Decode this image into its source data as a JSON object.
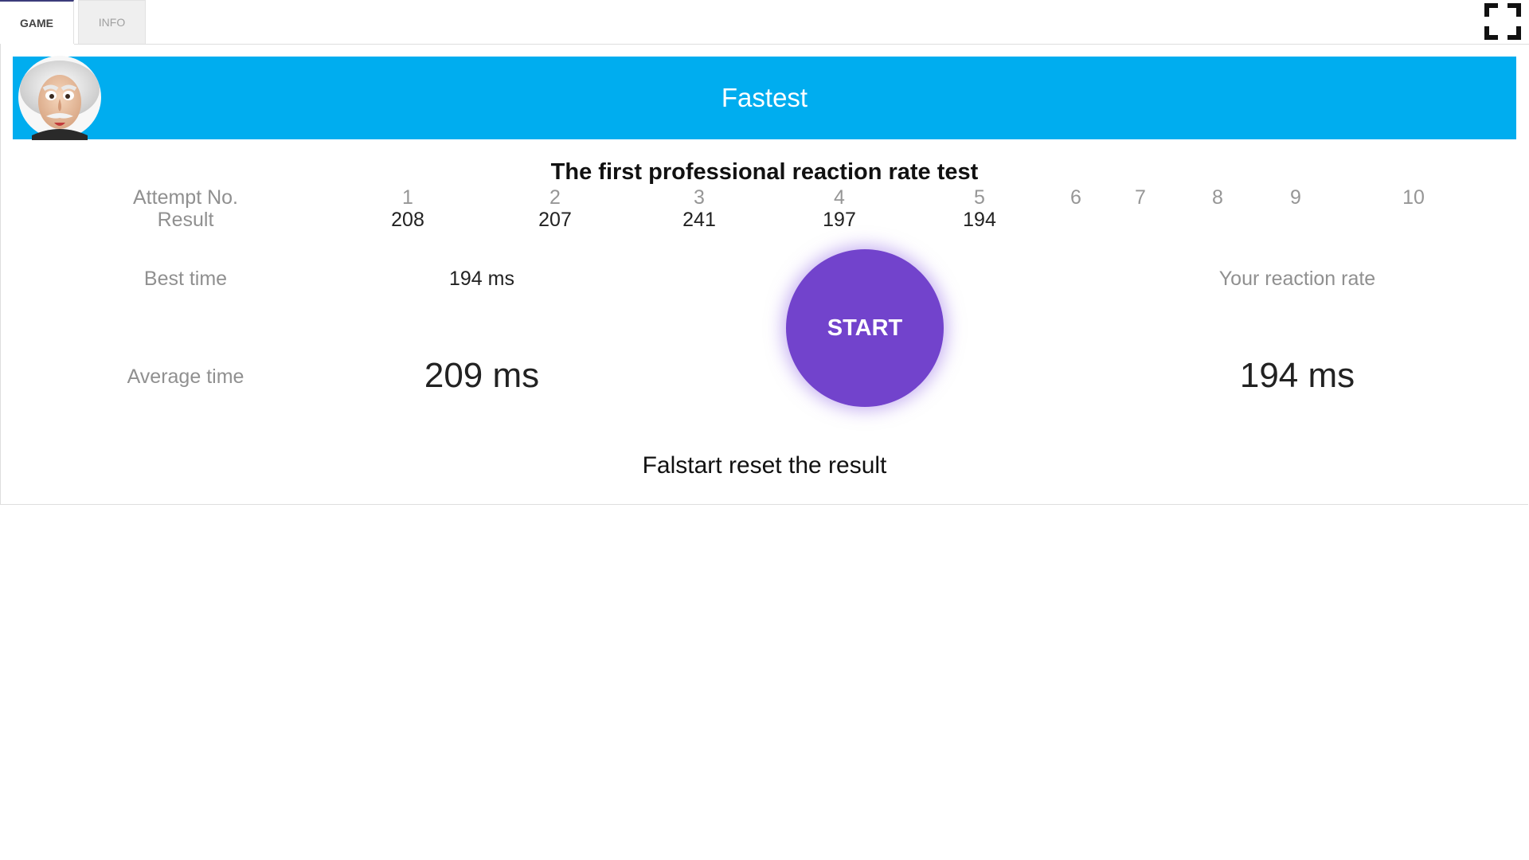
{
  "tabs": {
    "game": "GAME",
    "info": "INFO"
  },
  "header": {
    "title": "Fastest"
  },
  "subtitle": "The first professional reaction rate test",
  "table": {
    "attempt_label": "Attempt No.",
    "result_label": "Result",
    "attempts": [
      "1",
      "2",
      "3",
      "4",
      "5",
      "6",
      "7",
      "8",
      "9",
      "10"
    ],
    "results": [
      "208",
      "207",
      "241",
      "197",
      "194"
    ]
  },
  "stats": {
    "best_label": "Best time",
    "best_value": "194 ms",
    "average_label": "Average time",
    "average_value": "209 ms",
    "rate_label": "Your reaction rate",
    "rate_value": "194 ms"
  },
  "start_button": "START",
  "note": "Falstart reset the result",
  "colors": {
    "header_bg": "#00adef",
    "start_bg": "#7243cc"
  },
  "icons": {
    "fullscreen": "fullscreen-icon",
    "avatar": "einstein-avatar"
  }
}
